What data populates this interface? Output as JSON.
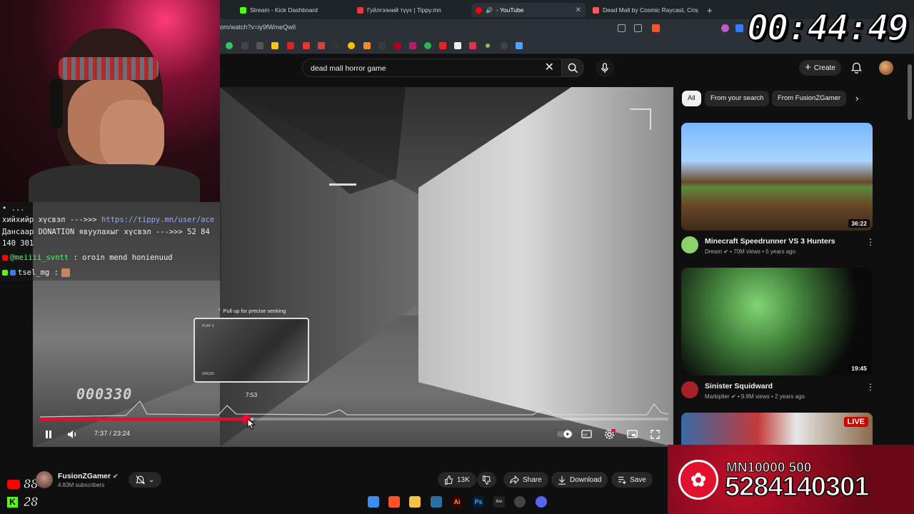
{
  "browser": {
    "tabs": [
      {
        "label": "Stream - Kick Dashboard",
        "icon": "kick-icon",
        "color": "#53fc18"
      },
      {
        "label": "Гуйлгээний түүх | Tippy.mn",
        "icon": "tippy-icon",
        "color": "#e03a4a"
      },
      {
        "label": "- YouTube",
        "icon": "youtube-icon",
        "color": "#ff0000"
      },
      {
        "label": "Dead Mall by Cosmic Raycast, Crisp",
        "icon": "itch-icon",
        "color": "#fa5c5c"
      }
    ],
    "new_tab": "+",
    "url": "om/watch?v=iy9fWmeQwlI"
  },
  "youtube": {
    "search": {
      "value": "dead mall horror game"
    },
    "create_label": "Create",
    "chips": [
      "All",
      "From your search",
      "From FusionZGamer"
    ],
    "chip_next": "›",
    "channel": {
      "name": "FusionZGamer",
      "subscribers": "4.83M subscribers"
    },
    "actions": {
      "likes": "13K",
      "share": "Share",
      "download": "Download",
      "save": "Save"
    }
  },
  "player": {
    "seek_hint": "⌃ Pull up for precise seeking",
    "seek_time": "7:53",
    "current_time": "7:37 / 23:24",
    "counter": "000330",
    "preview_label": "PLAY 4",
    "preview_label2": "000330",
    "played_fraction": 0.328,
    "buffer_fraction": 0.34
  },
  "recommendations": [
    {
      "title": "Minecraft Speedrunner VS 3 Hunters",
      "channel": "Dream",
      "meta": "70M views • 5 years ago",
      "duration": "36:22"
    },
    {
      "title": "Sinister Squidward",
      "channel": "Markiplier",
      "meta": "9.8M views • 2 years ago",
      "duration": "19:45"
    },
    {
      "title": "",
      "channel": "",
      "meta": "",
      "live": "LIVE"
    }
  ],
  "stream_overlay": {
    "timer": "00:44:49",
    "chat": [
      {
        "text": "хийхийр хүсвэл --->>> ",
        "link": "https://tippy.mn/user/ace"
      },
      {
        "text": "Дансаар DONATION явуулахыг хүсвэл --->>> 52 84"
      },
      {
        "text": "140 301"
      },
      {
        "user": "@meiiii_svntt",
        "text": " : oroin mend honienuud"
      },
      {
        "user": "tsel_mg",
        "text": " :"
      }
    ],
    "youtube_viewers": "88",
    "kick_viewers": "28",
    "donation_line1": "MN10000 500",
    "donation_line2": "5284140301"
  },
  "colors": {
    "accent": "#ff0033",
    "background": "#0f0f0f",
    "chip_bg": "#272727"
  }
}
